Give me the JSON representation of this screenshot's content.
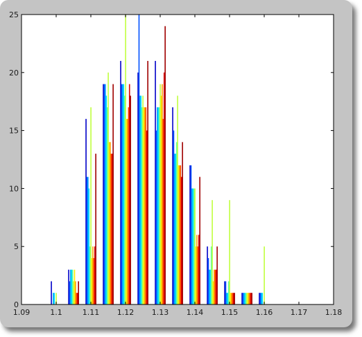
{
  "chart_data": {
    "type": "bar",
    "title": "",
    "xlabel": "",
    "ylabel": "",
    "xlim": [
      1.09,
      1.18
    ],
    "ylim": [
      0,
      25
    ],
    "grid": false,
    "legend": "none",
    "x_ticks": [
      1.09,
      1.1,
      1.11,
      1.12,
      1.13,
      1.14,
      1.15,
      1.16,
      1.17,
      1.18
    ],
    "x_tick_labels": [
      "1.09",
      "1.1",
      "1.11",
      "1.12",
      "1.13",
      "1.14",
      "1.15",
      "1.16",
      "1.17",
      "1.18"
    ],
    "y_ticks": [
      0,
      5,
      10,
      15,
      20,
      25
    ],
    "y_tick_labels": [
      "0",
      "5",
      "10",
      "15",
      "20",
      "25"
    ],
    "bin_width": 0.005,
    "bin_centers": [
      1.1,
      1.105,
      1.11,
      1.115,
      1.12,
      1.125,
      1.13,
      1.135,
      1.14,
      1.145,
      1.15,
      1.155,
      1.16
    ],
    "bar_colormap": [
      "#0000c8",
      "#0050ff",
      "#00a0ff",
      "#00e0ff",
      "#60ffa0",
      "#c0ff40",
      "#ffee00",
      "#ffa000",
      "#ff5000",
      "#e00000",
      "#a00000"
    ],
    "counts": [
      [
        2,
        0,
        1,
        1,
        0,
        1,
        0,
        0,
        0,
        0,
        0
      ],
      [
        3,
        2,
        3,
        3,
        3,
        2,
        3,
        2,
        1,
        1,
        2
      ],
      [
        16,
        11,
        11,
        10,
        5,
        17,
        4,
        5,
        4,
        5,
        13
      ],
      [
        19,
        19,
        19,
        18,
        17,
        20,
        14,
        14,
        13,
        13,
        19
      ],
      [
        21,
        19,
        19,
        19,
        18,
        25,
        16,
        16,
        17,
        19,
        18
      ],
      [
        20,
        25,
        18,
        18,
        17,
        18,
        17,
        17,
        17,
        15,
        21
      ],
      [
        21,
        15,
        17,
        17,
        17,
        19,
        18,
        19,
        16,
        20,
        24
      ],
      [
        17,
        15,
        13,
        13,
        14,
        18,
        12,
        12,
        12,
        11,
        14
      ],
      [
        12,
        12,
        10,
        10,
        10,
        10,
        5,
        6,
        5,
        6,
        11
      ],
      [
        5,
        4,
        3,
        3,
        5,
        9,
        2,
        3,
        3,
        3,
        5
      ],
      [
        2,
        2,
        1,
        1,
        2,
        9,
        1,
        1,
        1,
        1,
        1
      ],
      [
        1,
        1,
        1,
        1,
        1,
        1,
        1,
        1,
        1,
        1,
        1
      ],
      [
        1,
        1,
        1,
        1,
        0,
        5,
        0,
        0,
        0,
        0,
        0
      ]
    ]
  }
}
